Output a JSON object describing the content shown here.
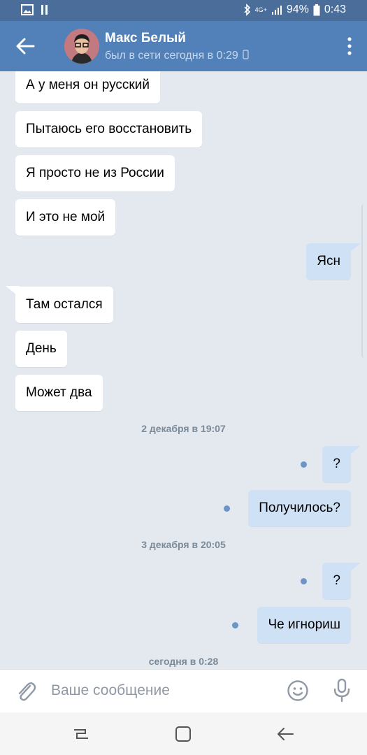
{
  "status_bar": {
    "battery": "94%",
    "time": "0:43",
    "network": "4G+"
  },
  "header": {
    "contact_name": "Макс Белый",
    "last_seen": "был в сети сегодня в 0:29"
  },
  "messages": [
    {
      "text": "А у меня он русский",
      "direction": "in"
    },
    {
      "text": "Пытаюсь его восстановить",
      "direction": "in"
    },
    {
      "text": "Я просто не из России",
      "direction": "in"
    },
    {
      "text": "И это не мой",
      "direction": "in"
    },
    {
      "text": "Ясн",
      "direction": "out"
    },
    {
      "text": "Там остался",
      "direction": "in"
    },
    {
      "text": "День",
      "direction": "in"
    },
    {
      "text": "Может два",
      "direction": "in"
    },
    {
      "text": "?",
      "direction": "out"
    },
    {
      "text": "Получилось?",
      "direction": "out"
    },
    {
      "text": "?",
      "direction": "out"
    },
    {
      "text": "Че игнориш",
      "direction": "out"
    }
  ],
  "dates": [
    "2 декабря в 19:07",
    "3 декабря в 20:05",
    "сегодня в 0:28"
  ],
  "input": {
    "placeholder": "Ваше сообщение"
  },
  "colors": {
    "header": "#5181b8",
    "outgoing": "#cfe1f5",
    "background": "#e3e9ef"
  },
  "icons": [
    "back-arrow-icon",
    "more-icon",
    "attach-icon",
    "emoji-icon",
    "mic-icon",
    "recent-apps-icon",
    "home-icon",
    "back-icon"
  ]
}
